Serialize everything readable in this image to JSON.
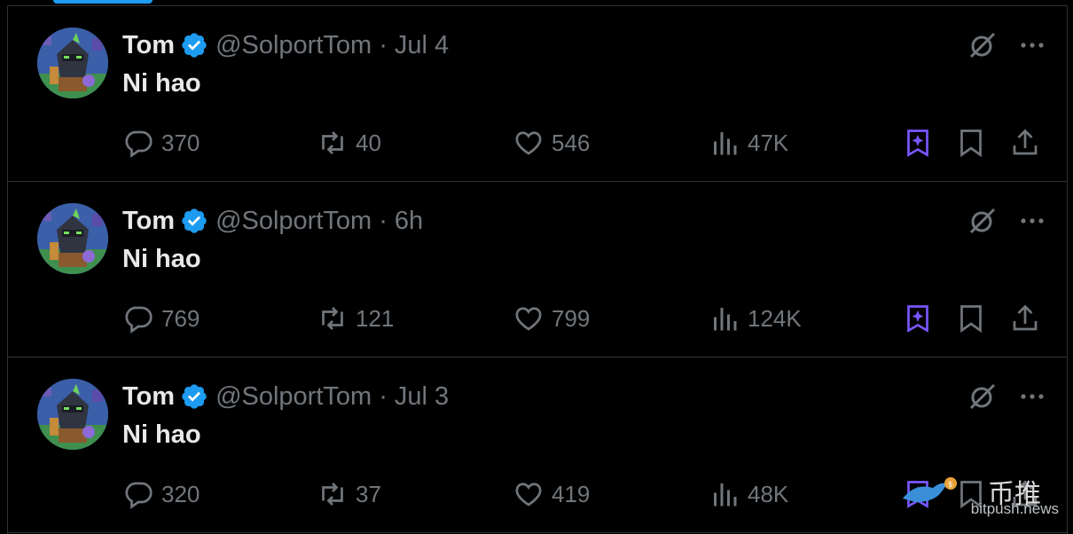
{
  "tweets": [
    {
      "name": "Tom",
      "handle": "@SolportTom",
      "separator": "·",
      "time": "Jul 4",
      "text": "Ni hao",
      "replies": "370",
      "retweets": "40",
      "likes": "546",
      "views": "47K"
    },
    {
      "name": "Tom",
      "handle": "@SolportTom",
      "separator": "·",
      "time": "6h",
      "text": "Ni hao",
      "replies": "769",
      "retweets": "121",
      "likes": "799",
      "views": "124K"
    },
    {
      "name": "Tom",
      "handle": "@SolportTom",
      "separator": "·",
      "time": "Jul 3",
      "text": "Ni hao",
      "replies": "320",
      "retweets": "37",
      "likes": "419",
      "views": "48K"
    }
  ],
  "icons": {
    "verified": "verified-badge-icon",
    "grok": "grok-icon",
    "more": "more-icon",
    "reply": "reply-icon",
    "retweet": "retweet-icon",
    "like": "heart-icon",
    "views": "views-icon",
    "grok_bookmark": "grok-bookmark-icon",
    "bookmark": "bookmark-icon",
    "share": "share-icon"
  },
  "colors": {
    "background": "#000000",
    "text": "#e7e9ea",
    "muted": "#71767b",
    "verified": "#1d9bf0",
    "grok_purple": "#7856ff",
    "divider": "#2f3336"
  },
  "watermark": {
    "brand_cn": "币推",
    "brand_url": "bitpush.news"
  }
}
